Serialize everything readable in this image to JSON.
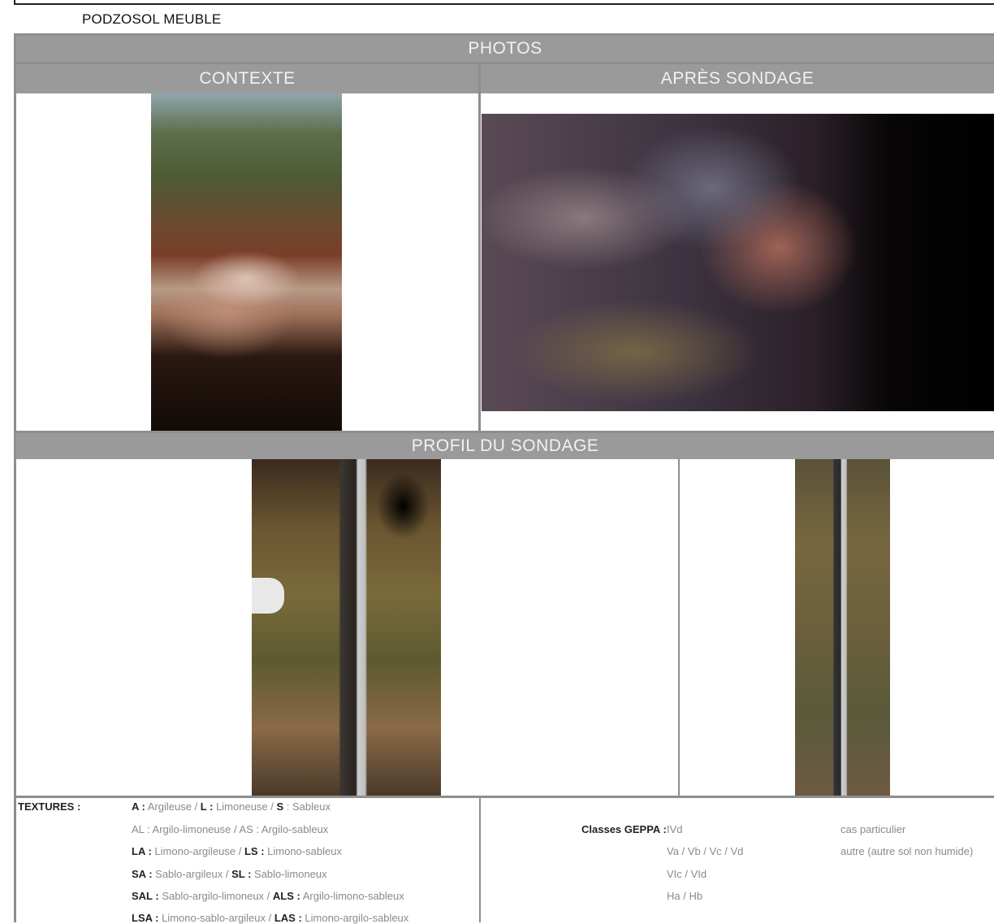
{
  "document": {
    "title": "PODZOSOL MEUBLE"
  },
  "sections": {
    "photos": "PHOTOS",
    "contexte": "CONTEXTE",
    "apres_sondage": "APRÈS SONDAGE",
    "profil": "PROFIL DU SONDAGE"
  },
  "textures": {
    "label": "TEXTURES :",
    "rows": [
      [
        {
          "code": "A :",
          "text": " Argileuse / "
        },
        {
          "code": "L :",
          "text": " Limoneuse / "
        },
        {
          "code": "S",
          "text": " : Sableux"
        }
      ],
      [
        {
          "code": "",
          "text": "AL : Argilo-limoneuse / AS : Argilo-sableux"
        }
      ],
      [
        {
          "code": "LA :",
          "text": " Limono-argileuse / "
        },
        {
          "code": "LS :",
          "text": " Limono-sableux"
        }
      ],
      [
        {
          "code": "SA :",
          "text": " Sablo-argileux / "
        },
        {
          "code": "SL :",
          "text": " Sablo-limoneux"
        }
      ],
      [
        {
          "code": "SAL :",
          "text": " Sablo-argilo-limoneux  / "
        },
        {
          "code": "ALS :",
          "text": " Argilo-limono-sableux"
        }
      ],
      [
        {
          "code": "LSA :",
          "text": " Limono-sablo-argileux /  "
        },
        {
          "code": "LAS :",
          "text": " Limono-argilo-sableux"
        }
      ]
    ]
  },
  "geppa": {
    "label": "Classes GEPPA :",
    "classes": [
      "IVd",
      "Va / Vb / Vc / Vd",
      "VIc / VId",
      "Ha / Hb"
    ],
    "notes": [
      "cas particulier",
      "autre (autre sol non humide)"
    ]
  }
}
